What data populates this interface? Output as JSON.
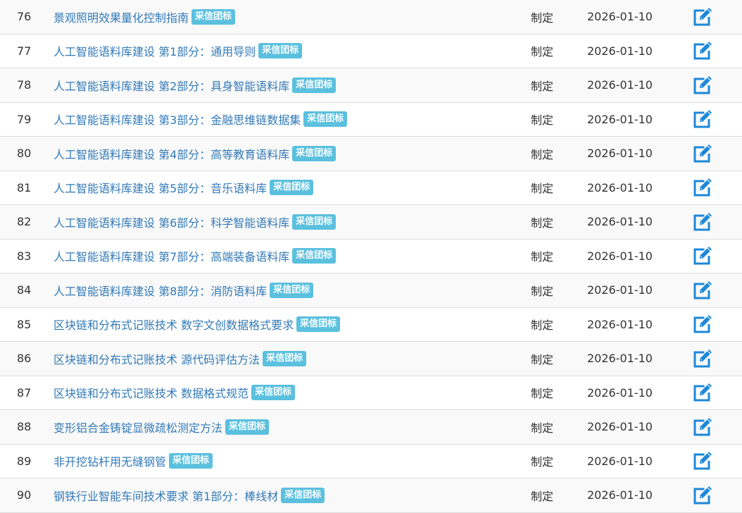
{
  "rows": [
    {
      "num": "76",
      "title": "景观照明效果量化控制指南",
      "badge": "采信团标",
      "status": "制定",
      "date": "2026-01-10",
      "icon": "edit-icon"
    },
    {
      "num": "77",
      "title": "人工智能语料库建设 第1部分：通用导则",
      "badge": "采信团标",
      "status": "制定",
      "date": "2026-01-10",
      "icon": "edit-icon"
    },
    {
      "num": "78",
      "title": "人工智能语料库建设 第2部分：具身智能语料库",
      "badge": "采信团标",
      "status": "制定",
      "date": "2026-01-10",
      "icon": "edit-icon"
    },
    {
      "num": "79",
      "title": "人工智能语料库建设 第3部分：金融思维链数据集",
      "badge": "采信团标",
      "status": "制定",
      "date": "2026-01-10",
      "icon": "edit-icon"
    },
    {
      "num": "80",
      "title": "人工智能语料库建设 第4部分：高等教育语料库",
      "badge": "采信团标",
      "status": "制定",
      "date": "2026-01-10",
      "icon": "edit-icon"
    },
    {
      "num": "81",
      "title": "人工智能语料库建设 第5部分：音乐语料库",
      "badge": "采信团标",
      "status": "制定",
      "date": "2026-01-10",
      "icon": "edit-icon"
    },
    {
      "num": "82",
      "title": "人工智能语料库建设 第6部分：科学智能语料库",
      "badge": "采信团标",
      "status": "制定",
      "date": "2026-01-10",
      "icon": "edit-icon"
    },
    {
      "num": "83",
      "title": "人工智能语料库建设 第7部分：高端装备语料库",
      "badge": "采信团标",
      "status": "制定",
      "date": "2026-01-10",
      "icon": "edit-icon"
    },
    {
      "num": "84",
      "title": "人工智能语料库建设 第8部分：消防语料库",
      "badge": "采信团标",
      "status": "制定",
      "date": "2026-01-10",
      "icon": "edit-icon"
    },
    {
      "num": "85",
      "title": "区块链和分布式记账技术 数字文创数据格式要求",
      "badge": "采信团标",
      "status": "制定",
      "date": "2026-01-10",
      "icon": "edit-icon"
    },
    {
      "num": "86",
      "title": "区块链和分布式记账技术 源代码评估方法",
      "badge": "采信团标",
      "status": "制定",
      "date": "2026-01-10",
      "icon": "edit-icon"
    },
    {
      "num": "87",
      "title": "区块链和分布式记账技术 数据格式规范 ",
      "badge": "采信团标",
      "status": "制定",
      "date": "2026-01-10",
      "icon": "edit-icon"
    },
    {
      "num": "88",
      "title": "变形铝合金铸锭显微疏松测定方法",
      "badge": "采信团标",
      "status": "制定",
      "date": "2026-01-10",
      "icon": "edit-icon"
    },
    {
      "num": "89",
      "title": "非开挖钻杆用无缝钢管",
      "badge": "采信团标",
      "status": "制定",
      "date": "2026-01-10",
      "icon": "edit-icon"
    },
    {
      "num": "90",
      "title": "钢铁行业智能车间技术要求 第1部分：棒线材",
      "badge": "采信团标",
      "status": "制定",
      "date": "2026-01-10",
      "icon": "edit-icon"
    }
  ],
  "colors": {
    "link": "#337ab7",
    "badge_bg": "#5bc0de",
    "icon": "#1e88d8",
    "stripe": "#f9f9f9",
    "border": "#dddddd"
  }
}
